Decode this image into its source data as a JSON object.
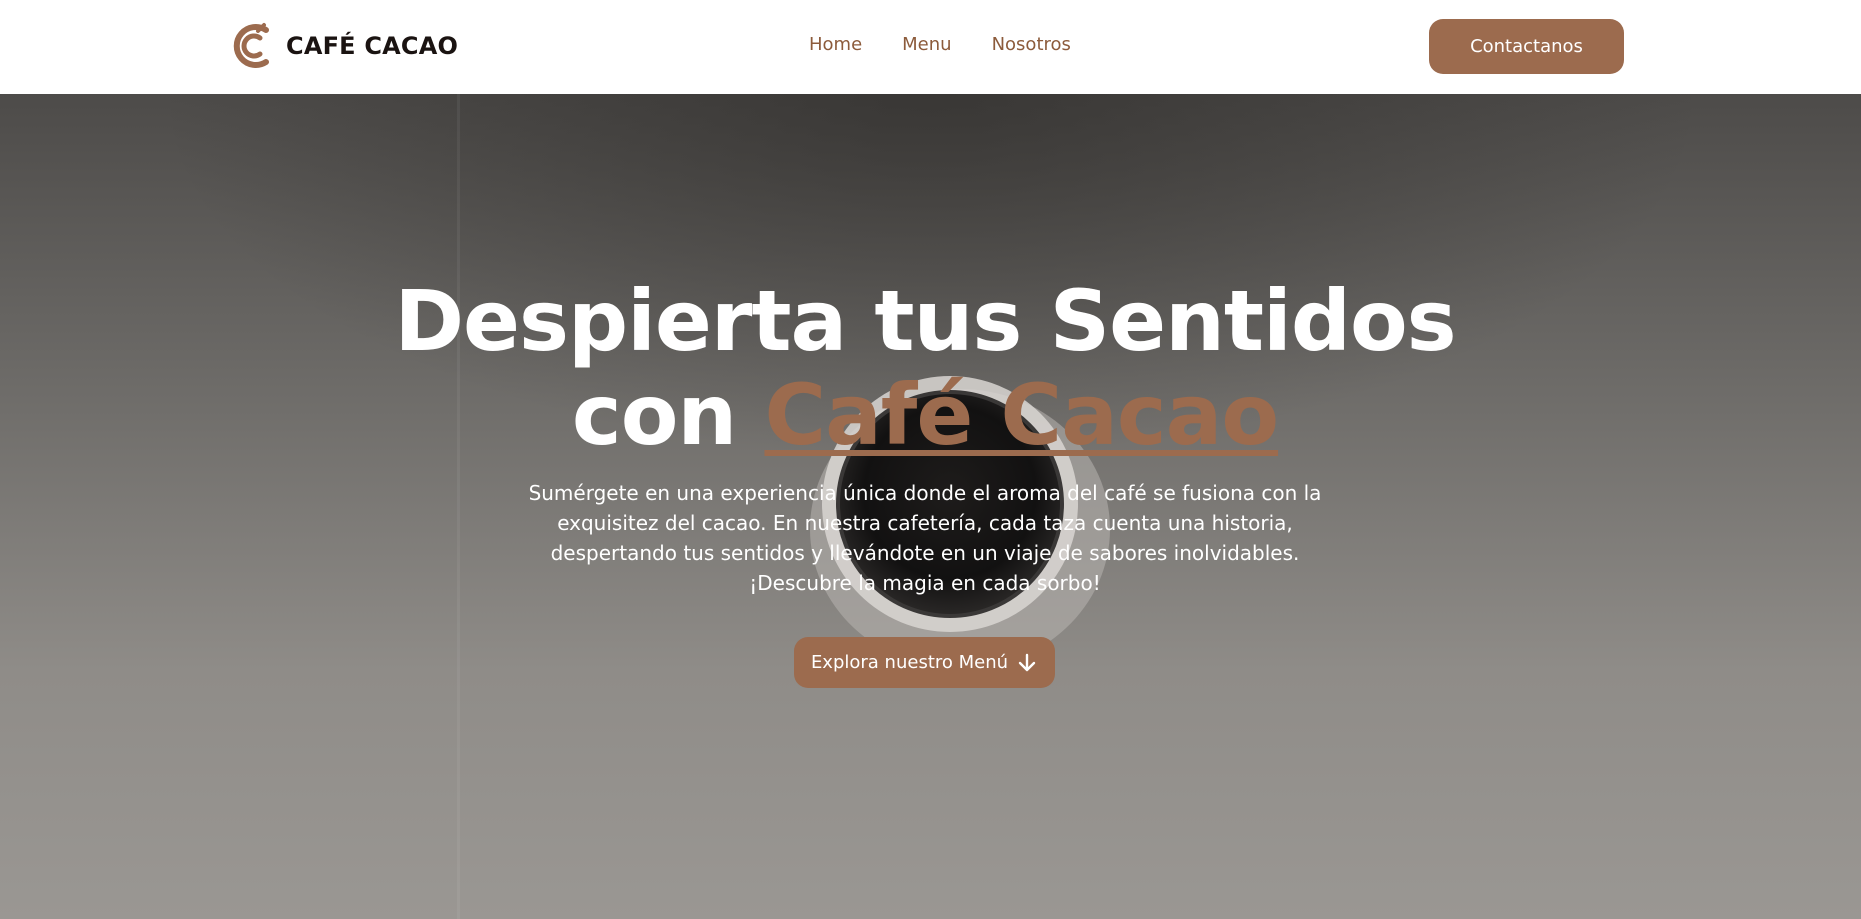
{
  "brand": {
    "name": "CAFÉ CACAO",
    "logo_icon": "coffee-bean-ring-icon"
  },
  "nav": {
    "links": [
      "Home",
      "Menu",
      "Nosotros"
    ],
    "contact_label": "Contactanos"
  },
  "hero": {
    "title_line1": "Despierta tus Sentidos",
    "title_line2_prefix": "con",
    "title_line2_accent": "Café Cacao",
    "description_lines": [
      "Sumérgete en una experiencia única donde el aroma del café se fusiona con la",
      "exquisitez del cacao. En nuestra cafetería, cada taza cuenta una historia,",
      "despertando tus sentidos y llevándote en un viaje de sabores inolvidables.",
      "¡Descubre la magia en cada sorbo!"
    ],
    "cta_label": "Explora nuestro Menú",
    "cta_icon": "arrow-down-icon",
    "background_icon": "coffee-cup-top-view-icon"
  },
  "colors": {
    "accent": "#9c6b4e",
    "nav_link": "#8c5b3b",
    "brand_text": "#1a1311",
    "hero_text": "#ffffff"
  }
}
